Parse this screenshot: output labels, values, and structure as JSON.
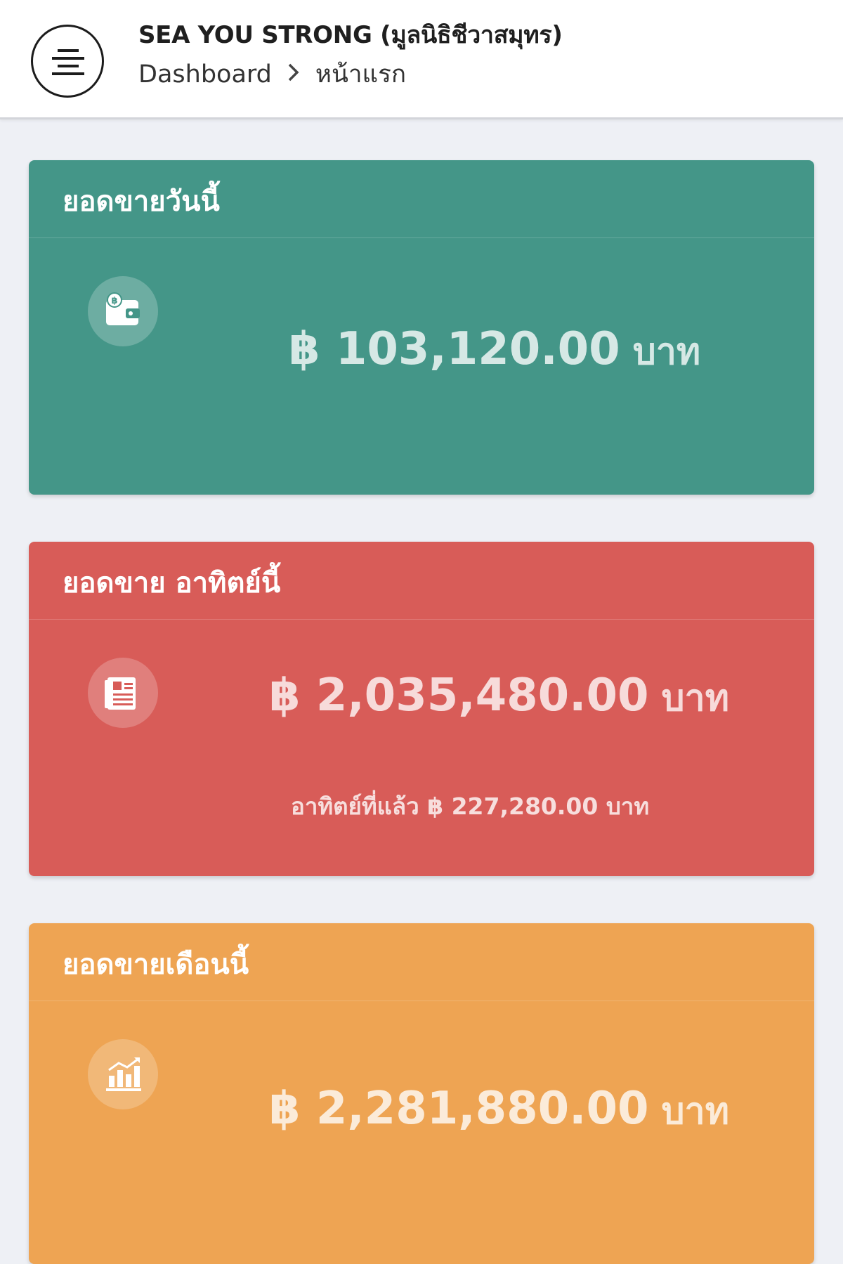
{
  "header": {
    "title": "SEA YOU STRONG (มูลนิธิชีวาสมุทร)",
    "breadcrumb": [
      "Dashboard",
      "หน้าแรก"
    ],
    "menu_icon": "menu-icon"
  },
  "cards": [
    {
      "title": "ยอดขายวันนี้",
      "icon": "wallet-icon",
      "amount": "฿ 103,120.00",
      "unit": "บาท",
      "color": "#449688"
    },
    {
      "title": "ยอดขาย อาทิตย์นี้",
      "icon": "document-icon",
      "amount": "฿ 2,035,480.00",
      "unit": "บาท",
      "sub_text": "อาทิตย์ที่แล้ว ฿ 227,280.00 บาท",
      "color": "#d85c58"
    },
    {
      "title": "ยอดขายเดือนนี้",
      "icon": "chart-icon",
      "amount": "฿ 2,281,880.00",
      "unit": "บาท",
      "color": "#eea453"
    }
  ]
}
